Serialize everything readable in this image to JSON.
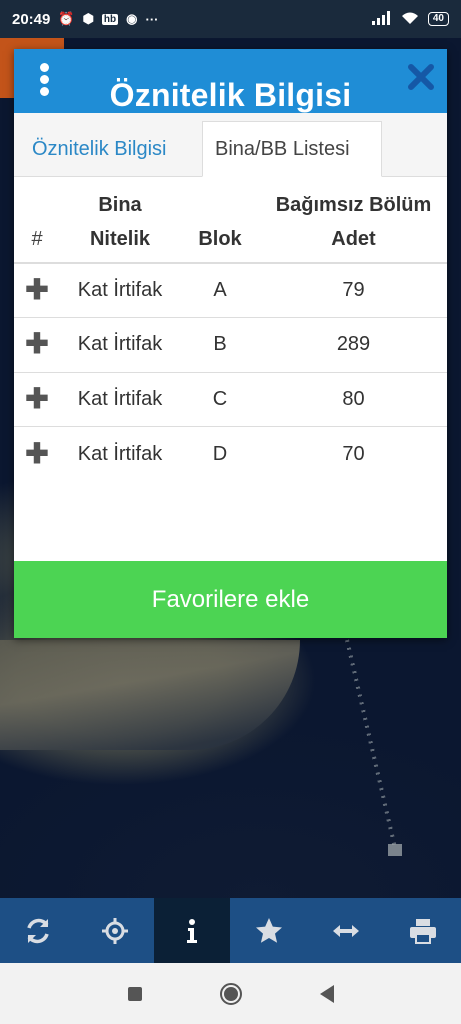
{
  "status_bar": {
    "time": "20:49",
    "more": "···",
    "hb": "hb",
    "battery": "40"
  },
  "dialog": {
    "title": "Öznitelik Bilgisi",
    "tabs": [
      {
        "label": "Öznitelik Bilgisi",
        "active": false
      },
      {
        "label": "Bina/BB Listesi",
        "active": true
      }
    ],
    "table": {
      "headers": {
        "hash": "#",
        "nitelik_line1": "Bina",
        "nitelik_line2": "Nitelik",
        "blok": "Blok",
        "adet_line1": "Bağımsız Bölüm",
        "adet_line2": "Adet"
      },
      "rows": [
        {
          "expand": "✚",
          "nitelik": "Kat İrtifak",
          "blok": "A",
          "adet": "79"
        },
        {
          "expand": "✚",
          "nitelik": "Kat İrtifak",
          "blok": "B",
          "adet": "289"
        },
        {
          "expand": "✚",
          "nitelik": "Kat İrtifak",
          "blok": "C",
          "adet": "80"
        },
        {
          "expand": "✚",
          "nitelik": "Kat İrtifak",
          "blok": "D",
          "adet": "70"
        }
      ]
    },
    "favorite_button": "Favorilere ekle"
  },
  "toolbar": {
    "items": [
      "refresh-icon",
      "locate-icon",
      "info-icon",
      "star-icon",
      "measure-icon",
      "print-icon"
    ],
    "active": "info-icon"
  },
  "colors": {
    "header_blue": "#1f8dd6",
    "tab_link_blue": "#2b88c6",
    "favorite_green": "#4cd453",
    "toolbar_blue": "#1d4f85"
  }
}
